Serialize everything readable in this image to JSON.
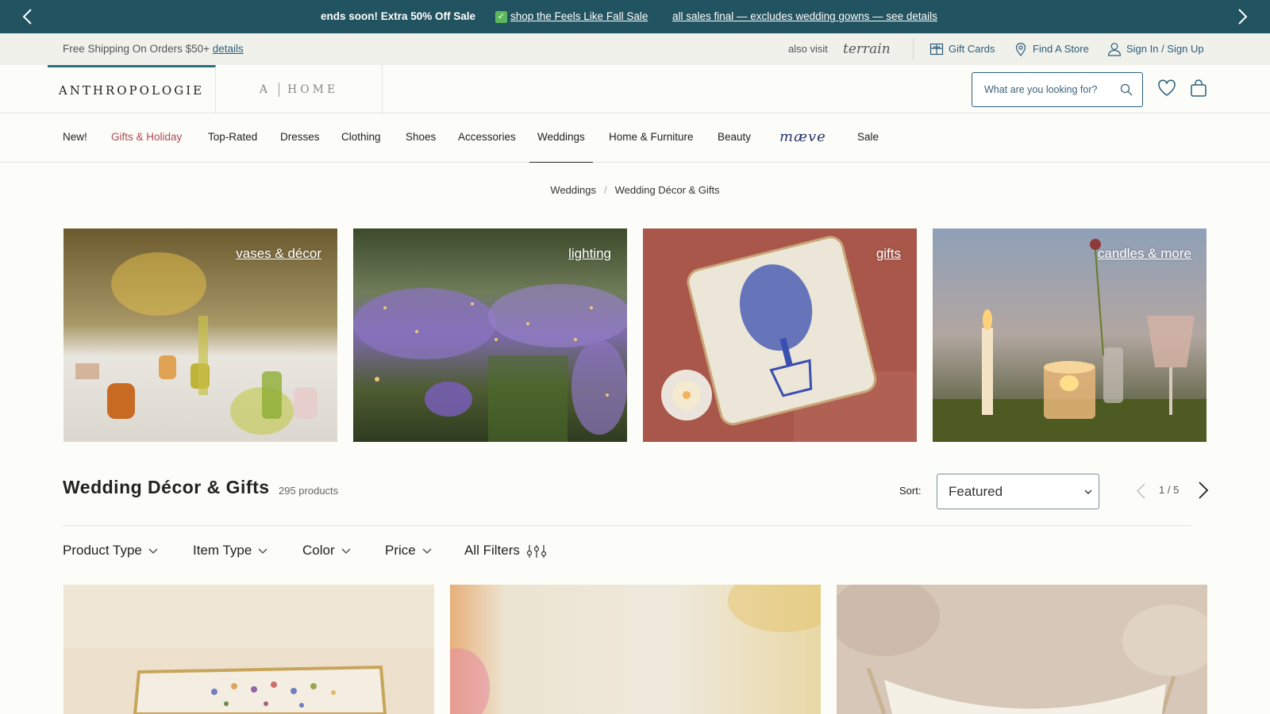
{
  "promo": {
    "messages": [
      "ends soon! Extra 50% Off Sale",
      "shop the Feels Like Fall Sale",
      "all sales final — excludes wedding gowns — see details"
    ],
    "check_glyph": "✓"
  },
  "utility": {
    "shipping_text": "Free Shipping On Orders $50+",
    "shipping_link": "details",
    "also_visit": "also visit",
    "terrain": "terrain",
    "gift_cards": "Gift Cards",
    "find_store": "Find A Store",
    "sign_in": "Sign In / Sign Up"
  },
  "header": {
    "brand": "ANTHROPOLOGIE",
    "home_a": "A",
    "home_word": "HOME",
    "search_placeholder": "What are you looking for?"
  },
  "nav": {
    "items": [
      "New!",
      "Gifts & Holiday",
      "Top-Rated",
      "Dresses",
      "Clothing",
      "Shoes",
      "Accessories",
      "Weddings",
      "Home & Furniture",
      "Beauty",
      "mæve",
      "Sale"
    ],
    "active": "Weddings",
    "highlighted": "Gifts & Holiday"
  },
  "breadcrumb": {
    "items": [
      "Weddings",
      "Wedding Décor & Gifts"
    ],
    "separator": "/"
  },
  "categories": [
    {
      "label": "vases & décor"
    },
    {
      "label": "lighting"
    },
    {
      "label": "gifts"
    },
    {
      "label": "candles & more"
    }
  ],
  "listing": {
    "title": "Wedding Décor & Gifts",
    "count": "295 products",
    "sort_label": "Sort:",
    "sort_value": "Featured",
    "page": "1 / 5"
  },
  "filters": [
    "Product Type",
    "Item Type",
    "Color",
    "Price",
    "All Filters"
  ],
  "colors": {
    "promo_bg": "#225360",
    "link": "#2b5e79",
    "accent_red": "#b04a56",
    "maeve": "#26356a"
  },
  "icons": [
    "chevron-left-icon",
    "chevron-right-icon",
    "gift-card-icon",
    "location-pin-icon",
    "user-icon",
    "search-icon",
    "heart-icon",
    "bag-icon",
    "chevron-down-icon",
    "sliders-icon"
  ]
}
